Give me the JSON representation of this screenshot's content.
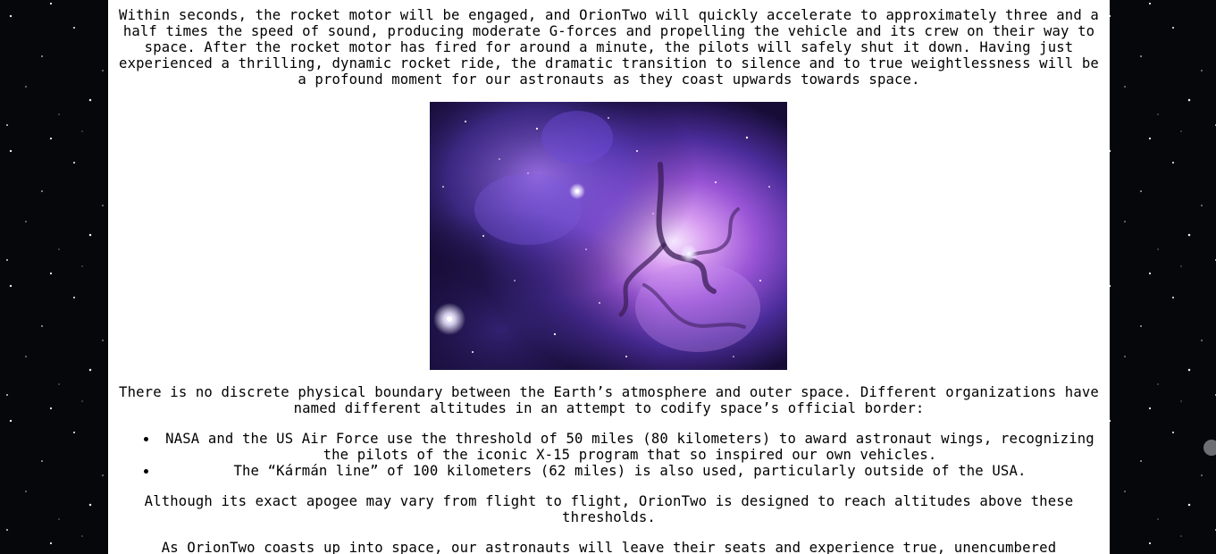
{
  "article": {
    "intro_paragraph": "Within seconds, the rocket motor will be engaged, and OrionTwo will quickly accelerate to approximately three and a half times the speed of sound, producing moderate G-forces and propelling the vehicle and its crew on their way to space. After the rocket motor has fired for around a minute, the pilots will safely shut it down. Having just experienced a thrilling, dynamic rocket ride, the dramatic transition to silence and to true weightlessness will be a profound moment for our astronauts as they coast upwards towards space.",
    "image": {
      "subject": "purple nebula star field"
    },
    "boundary_paragraph": "There is no discrete physical boundary between the Earth’s atmosphere and outer space. Different organizations have named different altitudes in an attempt to codify space’s official border:",
    "threshold_items": [
      "NASA and the US Air Force use the threshold of 50 miles (80 kilometers) to award astronaut wings, recognizing the pilots of the iconic X-15 program that so inspired our own vehicles.",
      "The “Kármán line” of 100 kilometers (62 miles) is also used, particularly outside of the USA."
    ],
    "apogee_paragraph": "Although its exact apogee may vary from flight to flight, OrionTwo is designed to reach altitudes above these thresholds.",
    "coast_paragraph": "As OrionTwo coasts up into space, our astronauts will leave their seats and experience true, unencumbered"
  },
  "colors": {
    "page_background": "#05070b",
    "column_background": "#ffffff",
    "text": "#000000"
  }
}
